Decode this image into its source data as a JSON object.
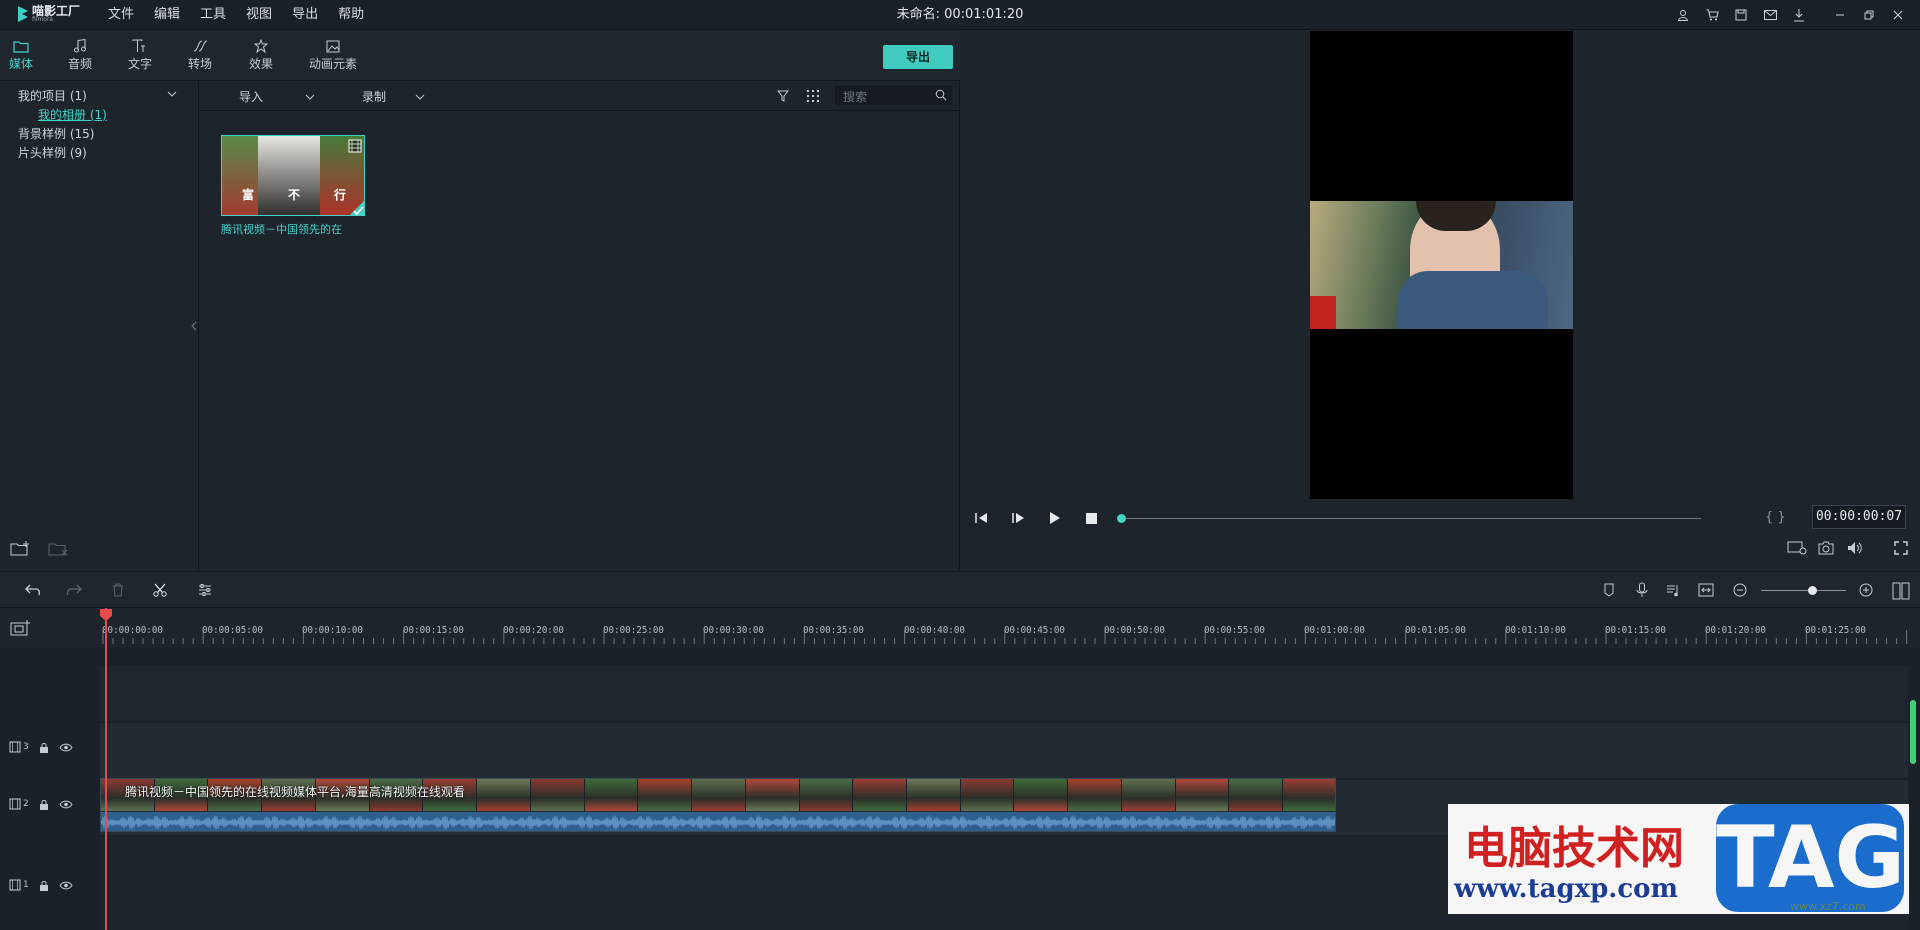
{
  "app": {
    "logo_text": "喵影工厂",
    "logo_sub": "filmora"
  },
  "menu": [
    "文件",
    "编辑",
    "工具",
    "视图",
    "导出",
    "帮助"
  ],
  "document_title": "未命名: 00:01:01:20",
  "window_icons": [
    "user-icon",
    "cart-icon",
    "save-icon",
    "mail-icon",
    "download-icon",
    "minimize-icon",
    "restore-icon",
    "close-icon"
  ],
  "tabs": [
    {
      "label": "媒体",
      "icon": "folder-icon",
      "active": true
    },
    {
      "label": "音频",
      "icon": "music-note-icon"
    },
    {
      "label": "文字",
      "icon": "text-icon"
    },
    {
      "label": "转场",
      "icon": "transition-icon"
    },
    {
      "label": "效果",
      "icon": "effects-icon"
    },
    {
      "label": "动画元素",
      "icon": "image-icon"
    }
  ],
  "export_button": "导出",
  "library_tree": {
    "my_project": "我的项目 (1)",
    "my_album": "我的相册 (1)",
    "bg_samples": "背景样例 (15)",
    "intro_samples": "片头样例 (9)"
  },
  "media_toolbar": {
    "import_label": "导入",
    "record_label": "录制",
    "search_placeholder": "搜索"
  },
  "media_items": [
    {
      "caption": "腾讯视频－中国领先的在",
      "thumb_text": [
        "富",
        "不",
        "行"
      ]
    }
  ],
  "preview": {
    "timecode": "00:00:00:07",
    "brackets": "{  }",
    "progress": 0.0
  },
  "ruler_labels": [
    "00:00:00:00",
    "00:00:05:00",
    "00:00:10:00",
    "00:00:15:00",
    "00:00:20:00",
    "00:00:25:00",
    "00:00:30:00",
    "00:00:35:00",
    "00:00:40:00",
    "00:00:45:00",
    "00:00:50:00",
    "00:00:55:00",
    "00:01:00:00",
    "00:01:05:00",
    "00:01:10:00",
    "00:01:15:00",
    "00:01:20:00",
    "00:01:25:00"
  ],
  "tracks": [
    {
      "number": "3"
    },
    {
      "number": "2"
    },
    {
      "number": "1"
    }
  ],
  "clip": {
    "title": "腾讯视频－中国领先的在线视频媒体平台,海量高清视频在线观看"
  },
  "watermark": {
    "text": "电脑技术网",
    "url": "www.tagxp.com",
    "tag": "TAG",
    "small": "www.xz7.com"
  },
  "colors": {
    "accent": "#45d3c7",
    "playhead": "#e84a4a",
    "audio": "#2f5f8f"
  }
}
